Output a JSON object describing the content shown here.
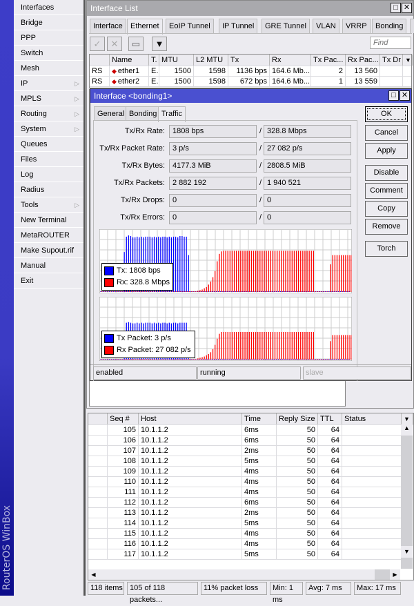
{
  "brand": "RouterOS WinBox",
  "menu": [
    {
      "label": "Interfaces"
    },
    {
      "label": "Bridge"
    },
    {
      "label": "PPP"
    },
    {
      "label": "Switch"
    },
    {
      "label": "Mesh"
    },
    {
      "label": "IP",
      "submenu": true
    },
    {
      "label": "MPLS",
      "submenu": true
    },
    {
      "label": "Routing",
      "submenu": true
    },
    {
      "label": "System",
      "submenu": true
    },
    {
      "label": "Queues"
    },
    {
      "label": "Files"
    },
    {
      "label": "Log"
    },
    {
      "label": "Radius"
    },
    {
      "label": "Tools",
      "submenu": true
    },
    {
      "label": "New Terminal"
    },
    {
      "label": "MetaROUTER"
    },
    {
      "label": "Make Supout.rif"
    },
    {
      "label": "Manual"
    },
    {
      "label": "Exit"
    }
  ],
  "menu_arrow": "▷",
  "iflist": {
    "title": "Interface List",
    "tabs": [
      "Interface",
      "Ethernet",
      "EoIP Tunnel",
      "IP Tunnel",
      "GRE Tunnel",
      "VLAN",
      "VRRP",
      "Bonding",
      "..."
    ],
    "active_tab": "Ethernet",
    "find_placeholder": "Find",
    "columns": [
      "",
      "Name",
      "T.",
      "MTU",
      "L2 MTU",
      "Tx",
      "Rx",
      "Tx Pac...",
      "Rx Pac...",
      "Tx Dr"
    ],
    "rows": [
      {
        "flags": "RS",
        "name": "ether1",
        "type": "E..",
        "mtu": "1500",
        "l2mtu": "1598",
        "tx": "1136 bps",
        "rx": "164.6 Mb...",
        "txpac": "2",
        "rxpac": "13 560"
      },
      {
        "flags": "RS",
        "name": "ether2",
        "type": "E..",
        "mtu": "1500",
        "l2mtu": "1598",
        "tx": "672 bps",
        "rx": "164.6 Mb...",
        "txpac": "1",
        "rxpac": "13 559"
      }
    ]
  },
  "dialog": {
    "title": "Interface <bonding1>",
    "tabs": [
      "General",
      "Bonding",
      "Traffic"
    ],
    "active_tab": "Traffic",
    "fields": [
      {
        "label": "Tx/Rx Rate:",
        "tx": "1808 bps",
        "rx": "328.8 Mbps"
      },
      {
        "label": "Tx/Rx Packet Rate:",
        "tx": "3 p/s",
        "rx": "27 082 p/s"
      },
      {
        "label": "Tx/Rx Bytes:",
        "tx": "4177.3 MiB",
        "rx": "2808.5 MiB"
      },
      {
        "label": "Tx/Rx Packets:",
        "tx": "2 882 192",
        "rx": "1 940 521"
      },
      {
        "label": "Tx/Rx Drops:",
        "tx": "0",
        "rx": "0"
      },
      {
        "label": "Tx/Rx Errors:",
        "tx": "0",
        "rx": "0"
      }
    ],
    "separator": "/",
    "buttons": [
      "OK",
      "Cancel",
      "Apply",
      "Disable",
      "Comment",
      "Copy",
      "Remove",
      "Torch"
    ],
    "status": [
      "enabled",
      "running",
      "slave"
    ],
    "legend_rate": {
      "tx": "Tx:  1808 bps",
      "rx": "Rx:  328.8 Mbps"
    },
    "legend_packet": {
      "tx": "Tx Packet:  3 p/s",
      "rx": "Rx Packet:  27 082 p/s"
    }
  },
  "colors": {
    "tx": "#0000ff",
    "rx": "#ff0000",
    "dialog_title": "#4a50d0",
    "brand": "#3d3dc8"
  },
  "chart_data": [
    {
      "type": "bar",
      "title": "",
      "ylim": [
        0,
        100
      ],
      "grid": true,
      "legend": "bottom-left",
      "series": [
        {
          "name": "Tx",
          "values": [
            1,
            1,
            1,
            1,
            1,
            1,
            1,
            1,
            1,
            1,
            1,
            65,
            90,
            92,
            91,
            89,
            89,
            90,
            89,
            90,
            89,
            90,
            90,
            90,
            89,
            90,
            89,
            90,
            89,
            90,
            90,
            89,
            90,
            89,
            90,
            90,
            89,
            91,
            91,
            90,
            90,
            60,
            1,
            1,
            1,
            1,
            1,
            1,
            1,
            1,
            1,
            1,
            1,
            1,
            1,
            1,
            1,
            1,
            1,
            1,
            1,
            1,
            1,
            1,
            1,
            1,
            1,
            1,
            1,
            1,
            1,
            1,
            1,
            1,
            1,
            1,
            1,
            1,
            1,
            1,
            1,
            1,
            1,
            1,
            1,
            1,
            1,
            1,
            1,
            1,
            1,
            1,
            1,
            1,
            1,
            1,
            1,
            1,
            1,
            1,
            1,
            1,
            1,
            1,
            1,
            1,
            1,
            1,
            1,
            1,
            1,
            1,
            1,
            1,
            1,
            1,
            1
          ]
        },
        {
          "name": "Rx",
          "values": [
            1,
            1,
            1,
            1,
            1,
            1,
            1,
            1,
            1,
            1,
            1,
            1,
            1,
            1,
            1,
            1,
            1,
            1,
            1,
            1,
            1,
            1,
            1,
            1,
            1,
            1,
            1,
            1,
            1,
            1,
            1,
            1,
            1,
            1,
            1,
            1,
            1,
            1,
            1,
            1,
            1,
            1,
            1,
            1,
            1,
            2,
            3,
            4,
            6,
            8,
            12,
            17,
            24,
            34,
            50,
            62,
            66,
            67,
            67,
            67,
            67,
            67,
            67,
            67,
            67,
            67,
            67,
            67,
            67,
            67,
            67,
            67,
            67,
            67,
            67,
            67,
            67,
            67,
            67,
            67,
            67,
            67,
            67,
            67,
            67,
            67,
            67,
            67,
            67,
            67,
            67,
            67,
            67,
            67,
            67,
            67,
            67,
            67,
            67,
            67,
            1,
            1,
            1,
            1,
            1,
            1,
            1,
            45,
            60,
            60,
            60,
            60,
            60,
            60,
            60,
            60,
            60,
            60,
            60,
            60,
            60
          ]
        }
      ]
    },
    {
      "type": "bar",
      "title": "",
      "ylim": [
        0,
        100
      ],
      "grid": true,
      "legend": "bottom-left",
      "series": [
        {
          "name": "Tx Packet",
          "values": [
            1,
            1,
            1,
            1,
            1,
            1,
            1,
            1,
            1,
            1,
            1,
            45,
            60,
            61,
            60,
            59,
            59,
            60,
            59,
            60,
            59,
            60,
            60,
            60,
            59,
            60,
            59,
            60,
            59,
            60,
            60,
            59,
            60,
            59,
            60,
            60,
            59,
            60,
            60,
            60,
            60,
            40,
            1,
            1,
            1,
            1,
            1,
            1,
            1,
            1,
            1,
            1,
            1,
            1,
            1,
            1,
            1,
            1,
            1,
            1,
            1,
            1,
            1,
            1,
            1,
            1,
            1,
            1,
            1,
            1,
            1,
            1,
            1,
            1,
            1,
            1,
            1,
            1,
            1,
            1,
            1,
            1,
            1,
            1,
            1,
            1,
            1,
            1,
            1,
            1,
            1,
            1,
            1,
            1,
            1,
            1,
            1,
            1,
            1,
            1,
            1,
            1,
            1,
            1,
            1,
            1,
            1,
            1,
            1,
            1,
            1,
            1,
            1,
            1,
            1,
            1,
            1
          ]
        },
        {
          "name": "Rx Packet",
          "values": [
            1,
            1,
            1,
            1,
            1,
            1,
            1,
            1,
            1,
            1,
            1,
            1,
            1,
            1,
            1,
            1,
            1,
            1,
            1,
            1,
            1,
            1,
            1,
            1,
            1,
            1,
            1,
            1,
            1,
            1,
            1,
            1,
            1,
            1,
            1,
            1,
            1,
            1,
            1,
            1,
            1,
            1,
            1,
            1,
            1,
            2,
            3,
            4,
            5,
            7,
            9,
            12,
            17,
            24,
            34,
            42,
            45,
            45,
            45,
            45,
            45,
            45,
            45,
            45,
            45,
            45,
            45,
            45,
            45,
            45,
            45,
            45,
            45,
            45,
            45,
            45,
            45,
            45,
            45,
            45,
            45,
            45,
            45,
            45,
            45,
            45,
            45,
            45,
            45,
            45,
            45,
            45,
            45,
            45,
            45,
            45,
            45,
            45,
            45,
            45,
            1,
            1,
            1,
            1,
            1,
            1,
            1,
            30,
            40,
            40,
            40,
            40,
            40,
            40,
            40,
            40,
            40,
            40,
            40,
            40,
            40
          ]
        }
      ]
    }
  ],
  "ping": {
    "columns": [
      "",
      "Seq #",
      "Host",
      "Time",
      "Reply Size",
      "TTL",
      "Status"
    ],
    "rows": [
      {
        "seq": "105",
        "host": "10.1.1.2",
        "time": "6ms",
        "size": "50",
        "ttl": "64"
      },
      {
        "seq": "106",
        "host": "10.1.1.2",
        "time": "6ms",
        "size": "50",
        "ttl": "64"
      },
      {
        "seq": "107",
        "host": "10.1.1.2",
        "time": "2ms",
        "size": "50",
        "ttl": "64"
      },
      {
        "seq": "108",
        "host": "10.1.1.2",
        "time": "5ms",
        "size": "50",
        "ttl": "64"
      },
      {
        "seq": "109",
        "host": "10.1.1.2",
        "time": "4ms",
        "size": "50",
        "ttl": "64"
      },
      {
        "seq": "110",
        "host": "10.1.1.2",
        "time": "4ms",
        "size": "50",
        "ttl": "64"
      },
      {
        "seq": "111",
        "host": "10.1.1.2",
        "time": "4ms",
        "size": "50",
        "ttl": "64"
      },
      {
        "seq": "112",
        "host": "10.1.1.2",
        "time": "6ms",
        "size": "50",
        "ttl": "64"
      },
      {
        "seq": "113",
        "host": "10.1.1.2",
        "time": "2ms",
        "size": "50",
        "ttl": "64"
      },
      {
        "seq": "114",
        "host": "10.1.1.2",
        "time": "5ms",
        "size": "50",
        "ttl": "64"
      },
      {
        "seq": "115",
        "host": "10.1.1.2",
        "time": "4ms",
        "size": "50",
        "ttl": "64"
      },
      {
        "seq": "116",
        "host": "10.1.1.2",
        "time": "4ms",
        "size": "50",
        "ttl": "64"
      },
      {
        "seq": "117",
        "host": "10.1.1.2",
        "time": "5ms",
        "size": "50",
        "ttl": "64"
      }
    ],
    "status": [
      "118 items",
      "105 of 118 packets...",
      "11% packet loss",
      "Min: 1 ms",
      "Avg: 7 ms",
      "Max: 17 ms"
    ]
  }
}
